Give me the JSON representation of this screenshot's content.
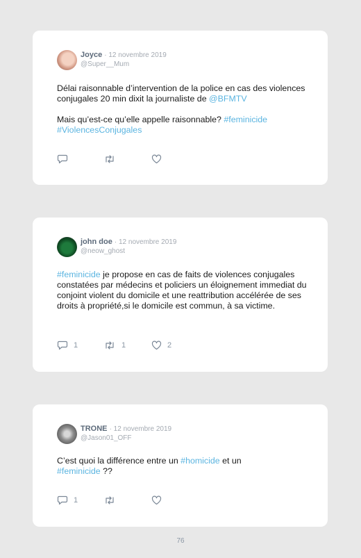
{
  "posts": [
    {
      "name": "Joyce",
      "date": "· 12 novembre 2019",
      "handle": "@Super__Mum",
      "text": {
        "p1_a": "Délai raisonnable d’intervention de la police en cas des violences conjugales 20 min dixit la journaliste de ",
        "p1_tag": "@BFMTV",
        "p2_a": "Mais qu’est-ce qu’elle appelle raisonnable? ",
        "p2_tag1": "#feminicide",
        "p2_tag2": "#ViolencesConjugales"
      },
      "replies": "",
      "retweets": "",
      "likes": ""
    },
    {
      "name": "john doe",
      "date": "· 12 novembre 2019",
      "handle": "@neow_ghost",
      "text": {
        "tag": "#feminicide",
        "rest": " je propose en cas de faits de violences conjugales constatées par médecins et policiers un éloignement immediat du conjoint violent du domicile et une reattribution accélérée de ses droits à propriété,si le domicile est commun, à sa victime."
      },
      "replies": "1",
      "retweets": "1",
      "likes": "2"
    },
    {
      "name": "TRONE",
      "date": "· 12 novembre 2019",
      "handle": "@Jason01_OFF",
      "text": {
        "a": "C’est quoi la différence entre un ",
        "tag1": "#homicide",
        "b": " et un ",
        "tag2": "#feminicide",
        "c": " ??"
      },
      "replies": "1",
      "retweets": "",
      "likes": ""
    }
  ],
  "icons": {
    "reply": "reply-icon",
    "retweet": "retweet-icon",
    "like": "heart-icon"
  },
  "colors": {
    "hashtag": "#5ab4e0",
    "name": "#5c6a7a",
    "meta": "#a4aab2",
    "background": "#e8e8e8"
  },
  "page_number": "76"
}
